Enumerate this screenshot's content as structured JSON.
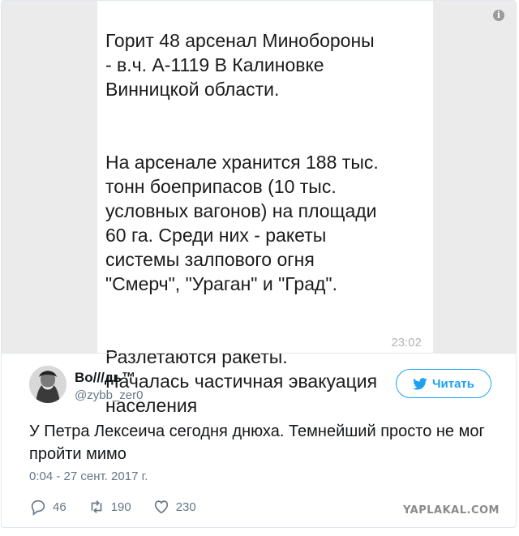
{
  "media": {
    "paragraphs": [
      "Горит 48 арсенал Минобороны\n- в.ч. А-1119 В Калиновке\nВинницкой области.",
      "На арсенале хранится 188 тыс.\nтонн боеприпасов (10 тыс.\nусловных вагонов) на площади\n60 га. Среди них - ракеты\nсистемы залпового огня\n\"Смерч\", \"Ураган\" и \"Град\".",
      "Разлетаются ракеты.\nНачалась частичная эвакуация\nнаселения"
    ],
    "time": "23:02",
    "info_icon": "i"
  },
  "author": {
    "name": "Во///дь™",
    "handle": "@zybb_zer0"
  },
  "follow_label": "Читать",
  "tweet": {
    "text": "У Петра Лексеича сегодня днюха. Темнейший просто не мог пройти мимо",
    "timestamp": "0:04 - 27 сент. 2017 г."
  },
  "actions": {
    "replies": "46",
    "retweets": "190",
    "likes": "230"
  },
  "watermark": "YAPLAKAL.COM",
  "colors": {
    "accent": "#1da1f2",
    "muted": "#657786",
    "text": "#14171a"
  }
}
